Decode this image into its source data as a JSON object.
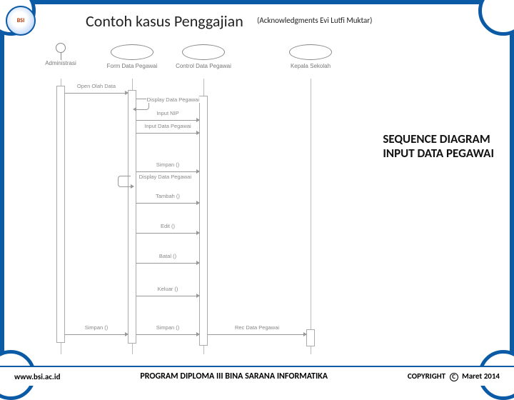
{
  "header": {
    "title": "Contoh kasus Penggajian",
    "ack": "(Acknowledgments Evi Lutfi Muktar)",
    "logo_text": "BSI"
  },
  "caption": {
    "line1": "SEQUENCE DIAGRAM",
    "line2": "INPUT DATA PEGAWAI"
  },
  "footer": {
    "left": "www.bsi.ac.id",
    "center": "PROGRAM DIPLOMA III BINA SARANA INFORMATIKA",
    "right_prefix": "COPYRIGHT",
    "right_suffix": "Maret 2014"
  },
  "lanes": {
    "l1": "Administrasi",
    "l2": "Form Data Pegawai",
    "l3": "Control Data Pegawai",
    "l4": "Kepala Sekolah"
  },
  "messages": {
    "m1": "Open Olah Data",
    "m2": "Display Data Pegawai",
    "m3": "Input NIP",
    "m4": "Input Data Pegawai",
    "m5": "Simpan ()",
    "m6": "Display Data Pegawai",
    "m7": "Tambah ()",
    "m8": "Edit ()",
    "m9": "Batal ()",
    "m10": "Keluar ()",
    "m11": "Simpan ()",
    "m12": "Simpan ()",
    "m13": "Rec Data Pegawai"
  },
  "chart_data": {
    "type": "sequence-diagram",
    "title": "SEQUENCE DIAGRAM INPUT DATA PEGAWAI",
    "participants": [
      {
        "id": "admin",
        "name": "Administrasi",
        "kind": "actor"
      },
      {
        "id": "form",
        "name": "Form Data Pegawai",
        "kind": "boundary"
      },
      {
        "id": "control",
        "name": "Control Data Pegawai",
        "kind": "control"
      },
      {
        "id": "kepala",
        "name": "Kepala Sekolah",
        "kind": "actor"
      }
    ],
    "messages": [
      {
        "from": "admin",
        "to": "form",
        "label": "Open Olah Data"
      },
      {
        "from": "form",
        "to": "form",
        "label": "Display Data Pegawai",
        "self": true
      },
      {
        "from": "form",
        "to": "control",
        "label": "Input NIP"
      },
      {
        "from": "form",
        "to": "control",
        "label": "Input Data Pegawai"
      },
      {
        "from": "form",
        "to": "control",
        "label": "Simpan ()"
      },
      {
        "from": "form",
        "to": "form",
        "label": "Display Data Pegawai",
        "self": true
      },
      {
        "from": "form",
        "to": "control",
        "label": "Tambah ()"
      },
      {
        "from": "form",
        "to": "control",
        "label": "Edit ()"
      },
      {
        "from": "form",
        "to": "control",
        "label": "Batal ()"
      },
      {
        "from": "form",
        "to": "control",
        "label": "Keluar ()"
      },
      {
        "from": "admin",
        "to": "form",
        "label": "Simpan ()"
      },
      {
        "from": "form",
        "to": "control",
        "label": "Simpan ()"
      },
      {
        "from": "control",
        "to": "kepala",
        "label": "Rec Data Pegawai"
      }
    ]
  }
}
